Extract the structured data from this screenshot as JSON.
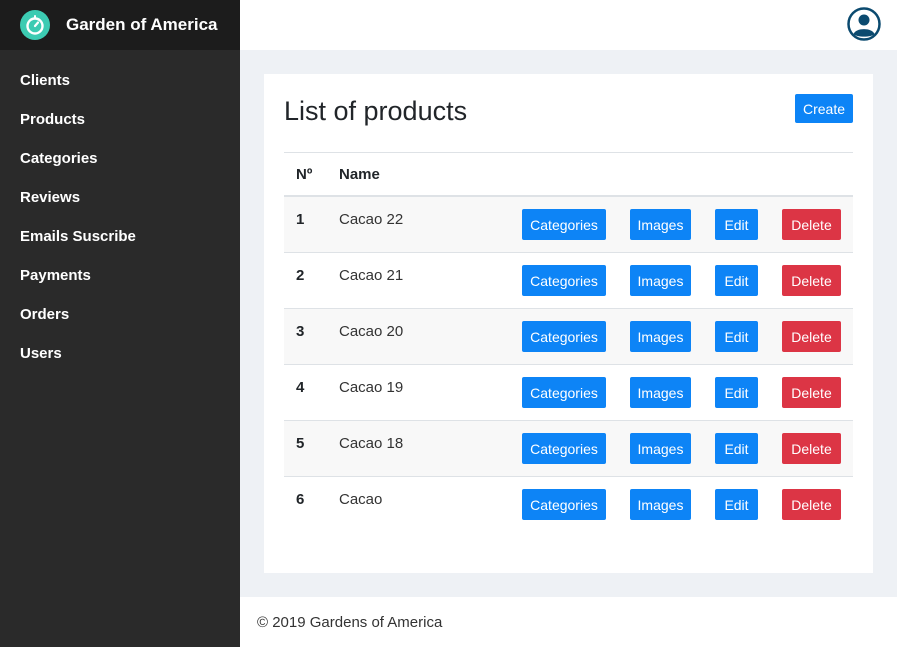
{
  "brand": {
    "title": "Garden of America",
    "logo_icon": "timer-logo-icon",
    "accent": "#3ccbb2"
  },
  "sidebar": {
    "items": [
      {
        "label": "Clients"
      },
      {
        "label": "Products"
      },
      {
        "label": "Categories"
      },
      {
        "label": "Reviews"
      },
      {
        "label": "Emails Suscribe"
      },
      {
        "label": "Payments"
      },
      {
        "label": "Orders"
      },
      {
        "label": "Users"
      }
    ]
  },
  "header": {
    "avatar_icon": "user-avatar-icon"
  },
  "main": {
    "title": "List of products",
    "create_label": "Create",
    "columns": {
      "number": "Nº",
      "name": "Name"
    },
    "rows": [
      {
        "num": "1",
        "name": "Cacao 22"
      },
      {
        "num": "2",
        "name": "Cacao 21"
      },
      {
        "num": "3",
        "name": "Cacao 20"
      },
      {
        "num": "4",
        "name": "Cacao 19"
      },
      {
        "num": "5",
        "name": "Cacao 18"
      },
      {
        "num": "6",
        "name": "Cacao"
      }
    ],
    "row_actions": {
      "categories": "Categories",
      "images": "Images",
      "edit": "Edit",
      "delete": "Delete"
    }
  },
  "footer": {
    "text": "© 2019 Gardens of America"
  },
  "colors": {
    "primary": "#0d84f6",
    "danger": "#dc3545",
    "sidebar": "#2a2a2a"
  }
}
